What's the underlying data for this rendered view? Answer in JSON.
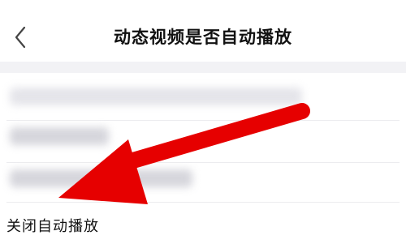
{
  "header": {
    "title": "动态视频是否自动播放",
    "back_icon": "chevron-left-icon"
  },
  "options": {
    "items": [
      {
        "label": "",
        "state": "blurred"
      },
      {
        "label": "",
        "state": "blurred"
      },
      {
        "label": "",
        "state": "blurred"
      },
      {
        "label": "关闭自动播放",
        "state": "visible"
      }
    ]
  },
  "annotation": {
    "type": "arrow",
    "color": "#e60000",
    "points_to": "options.items.3"
  }
}
